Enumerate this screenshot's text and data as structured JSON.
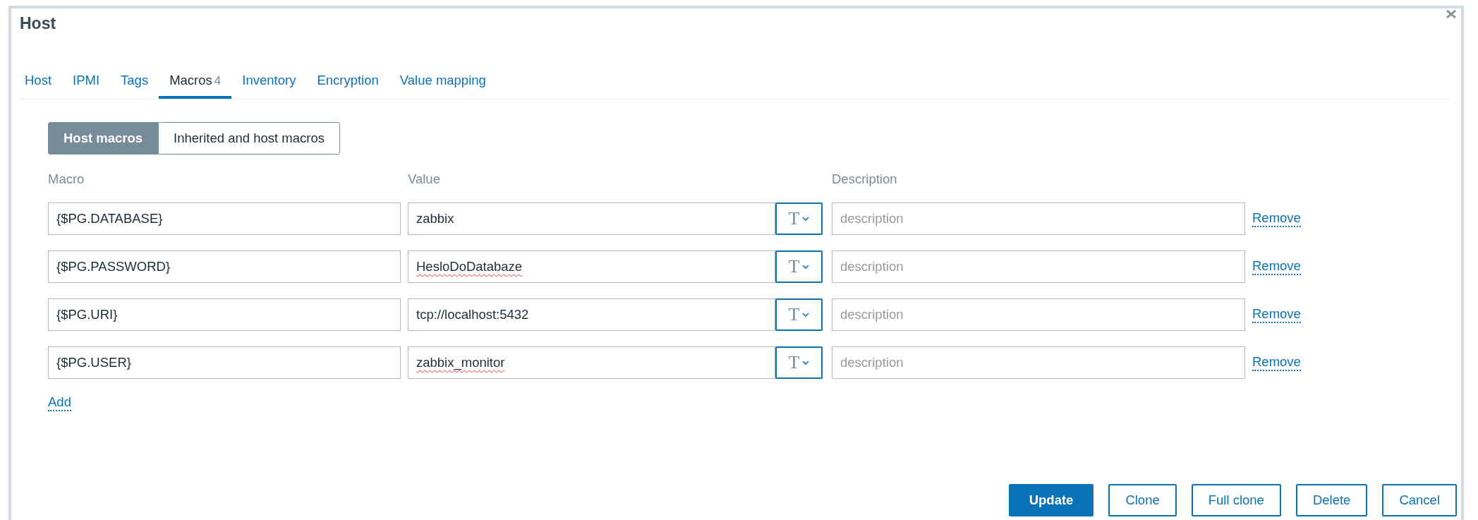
{
  "dialog": {
    "title": "Host"
  },
  "tabs": [
    {
      "label": "Host",
      "selected": false
    },
    {
      "label": "IPMI",
      "selected": false
    },
    {
      "label": "Tags",
      "selected": false
    },
    {
      "label": "Macros",
      "count": "4",
      "selected": true
    },
    {
      "label": "Inventory",
      "selected": false
    },
    {
      "label": "Encryption",
      "selected": false
    },
    {
      "label": "Value mapping",
      "selected": false
    }
  ],
  "macro_views": [
    {
      "label": "Host macros",
      "selected": true
    },
    {
      "label": "Inherited and host macros",
      "selected": false
    }
  ],
  "columns": [
    "Macro",
    "Value",
    "Description"
  ],
  "macros": [
    {
      "macro": "{$PG.DATABASE}",
      "value": "zabbix",
      "misspelled": false,
      "type_label": "T",
      "description_placeholder": "description",
      "remove": "Remove"
    },
    {
      "macro": "{$PG.PASSWORD}",
      "value": "HesloDoDatabaze",
      "misspelled": true,
      "type_label": "T",
      "description_placeholder": "description",
      "remove": "Remove"
    },
    {
      "macro": "{$PG.URI}",
      "value": "tcp://localhost:5432",
      "misspelled": false,
      "type_label": "T",
      "description_placeholder": "description",
      "remove": "Remove"
    },
    {
      "macro": "{$PG.USER}",
      "value": "zabbix_monitor",
      "misspelled": true,
      "type_label": "T",
      "description_placeholder": "description",
      "remove": "Remove"
    }
  ],
  "add_link": "Add",
  "buttons": [
    {
      "label": "Update",
      "kind": "primary"
    },
    {
      "label": "Clone",
      "kind": "secondary"
    },
    {
      "label": "Full clone",
      "kind": "secondary"
    },
    {
      "label": "Delete",
      "kind": "secondary"
    },
    {
      "label": "Cancel",
      "kind": "secondary"
    }
  ]
}
